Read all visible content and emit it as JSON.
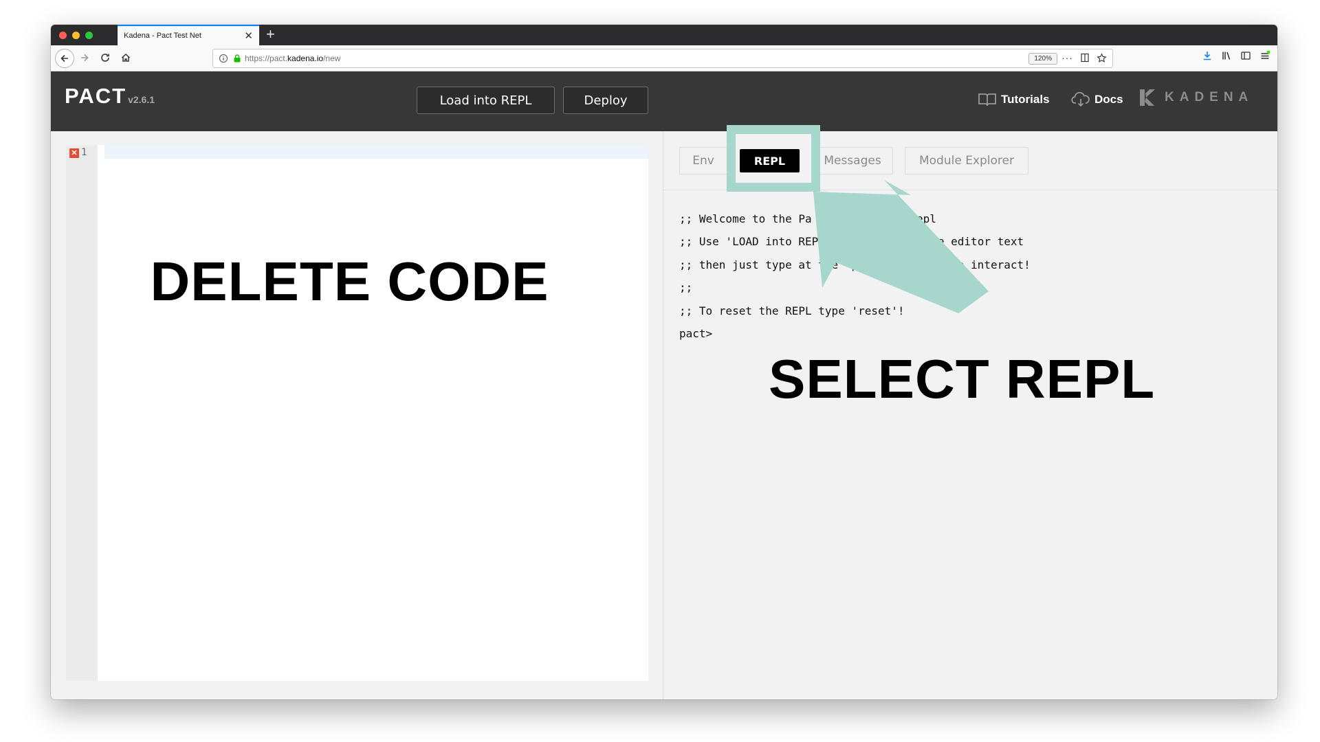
{
  "browser": {
    "tab_title": "Kadena - Pact Test Net",
    "url_prefix": "https://pact.",
    "url_host": "kadena.io",
    "url_path": "/new",
    "zoom": "120%"
  },
  "header": {
    "brand_name": "PACT",
    "brand_version": "v2.6.1",
    "load_button": "Load into REPL",
    "deploy_button": "Deploy",
    "tutorials_link": "Tutorials",
    "docs_link": "Docs",
    "kadena_logo": "KADENA"
  },
  "editor": {
    "line_number": "1",
    "error_marker": "✕"
  },
  "tabs": {
    "env": "Env",
    "repl": "REPL",
    "messages": "Messages",
    "module_explorer": "Module Explorer"
  },
  "console": {
    "lines": [
      ";; Welcome to the Pa",
      ";; Use 'LOAD into REP",
      ";; then just type at the \"pa",
      ";;",
      ";; To reset the REPL type 'reset'!"
    ],
    "line_tails": [
      "eractive repl",
      "on to execute editor text",
      "prompt to interact!",
      "",
      ""
    ],
    "prompt": "pact>"
  },
  "annotations": {
    "left_overlay": "DELETE CODE",
    "right_overlay": "SELECT REPL",
    "highlight_color": "#a7d7cc"
  }
}
